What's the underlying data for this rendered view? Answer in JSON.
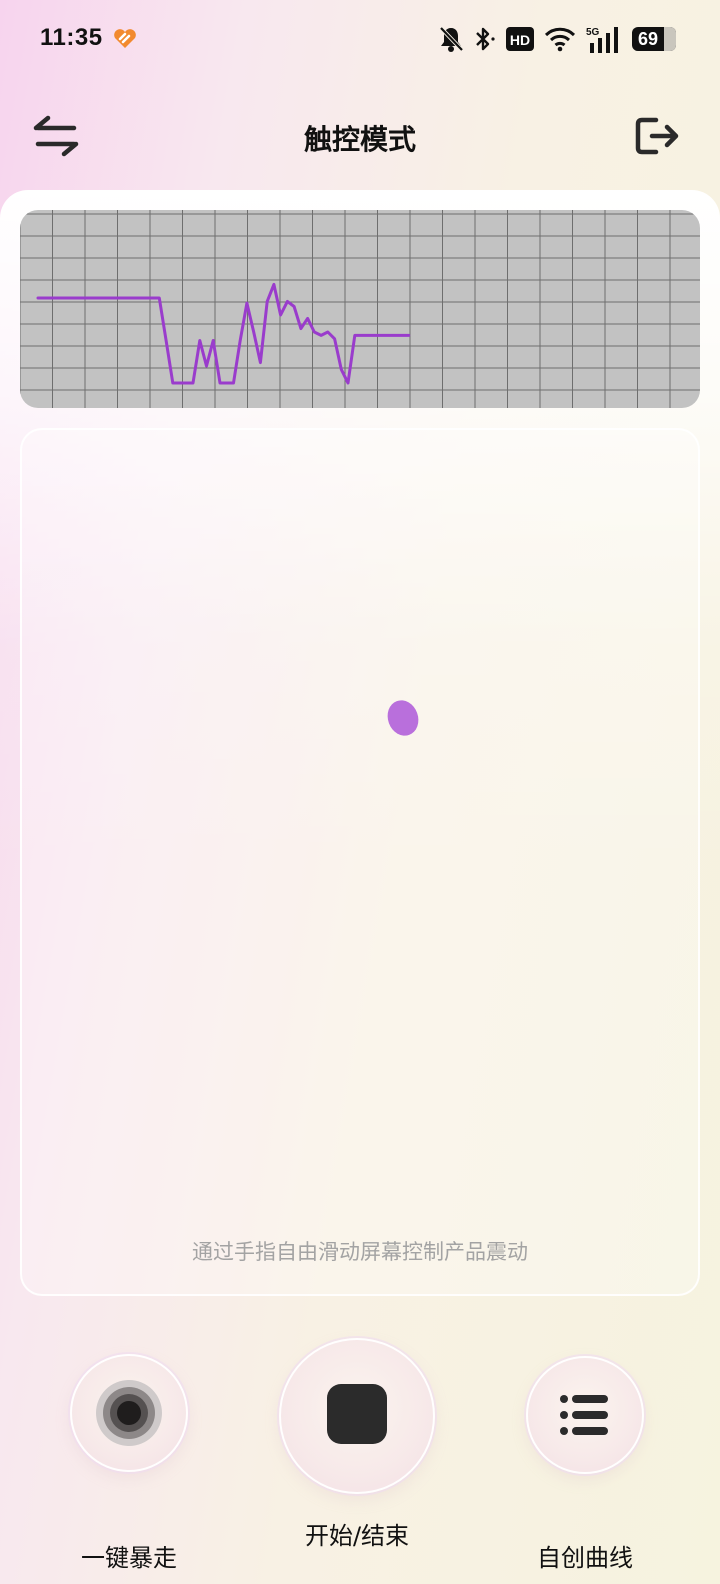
{
  "status_bar": {
    "time": "11:35",
    "app_icon": "heart-app-icon",
    "battery": "69",
    "network": "5G",
    "hd": "HD",
    "icons": [
      "mute-bell-icon",
      "bluetooth-icon",
      "hd-icon",
      "wifi-icon",
      "signal-5g-icon",
      "battery-icon"
    ]
  },
  "header": {
    "title": "触控模式",
    "left_icon": "swap-arrows-icon",
    "right_icon": "exit-icon"
  },
  "chart_data": {
    "type": "line",
    "grid": true,
    "line_color": "#9a3ccc",
    "background_color": "#c2c2c2",
    "ylim": [
      0,
      100
    ],
    "x": [
      0,
      4,
      8,
      12,
      16,
      18,
      19,
      20,
      21,
      22,
      23,
      24,
      25,
      26,
      27,
      28,
      29,
      30,
      31,
      32,
      33,
      34,
      35,
      36,
      37,
      38,
      39,
      40,
      41,
      42,
      43,
      44,
      45,
      46,
      47,
      48,
      49,
      50,
      51,
      52,
      53,
      54,
      55
    ],
    "values": [
      60,
      60,
      60,
      60,
      60,
      60,
      35,
      10,
      10,
      10,
      10,
      35,
      20,
      35,
      10,
      10,
      10,
      35,
      57,
      40,
      22,
      58,
      68,
      50,
      58,
      55,
      42,
      48,
      40,
      38,
      40,
      36,
      18,
      10,
      38,
      38,
      38,
      38,
      38,
      38,
      38,
      38,
      38
    ]
  },
  "touch_area": {
    "hint": "通过手指自由滑动屏幕控制产品震动",
    "dot_color": "#b96fdc"
  },
  "actions": [
    {
      "label": "一键暴走",
      "icon": "vortex-icon"
    },
    {
      "label": "开始/结束",
      "icon": "stop-icon"
    },
    {
      "label": "自创曲线",
      "icon": "list-icon"
    }
  ]
}
